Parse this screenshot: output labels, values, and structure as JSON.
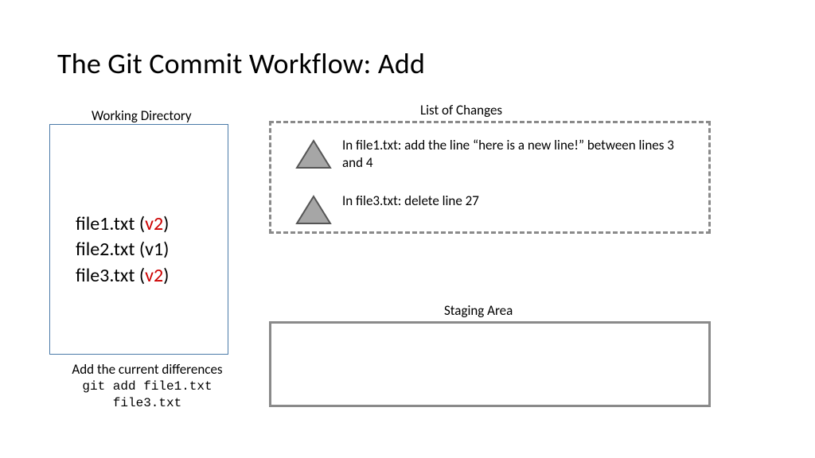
{
  "title": "The Git Commit Workflow: Add",
  "working_directory": {
    "label": "Working Directory",
    "files": [
      {
        "name": "file1.txt",
        "version": "v2",
        "highlight": true
      },
      {
        "name": "file2.txt",
        "version": "v1",
        "highlight": false
      },
      {
        "name": "file3.txt",
        "version": "v2",
        "highlight": true
      }
    ],
    "caption_line1": "Add the current differences",
    "caption_line2": "git add file1.txt file3.txt"
  },
  "changes": {
    "label": "List of Changes",
    "items": [
      "In file1.txt: add the line “here is a new line!” between lines 3 and 4",
      "In file3.txt: delete line 27"
    ]
  },
  "staging": {
    "label": "Staging Area"
  },
  "colors": {
    "highlight_version": "#cc0000",
    "box_border_blue": "#4a7aa8",
    "box_border_gray": "#8a8a8a",
    "triangle_fill": "#a6a6a6",
    "triangle_stroke": "#555555"
  }
}
